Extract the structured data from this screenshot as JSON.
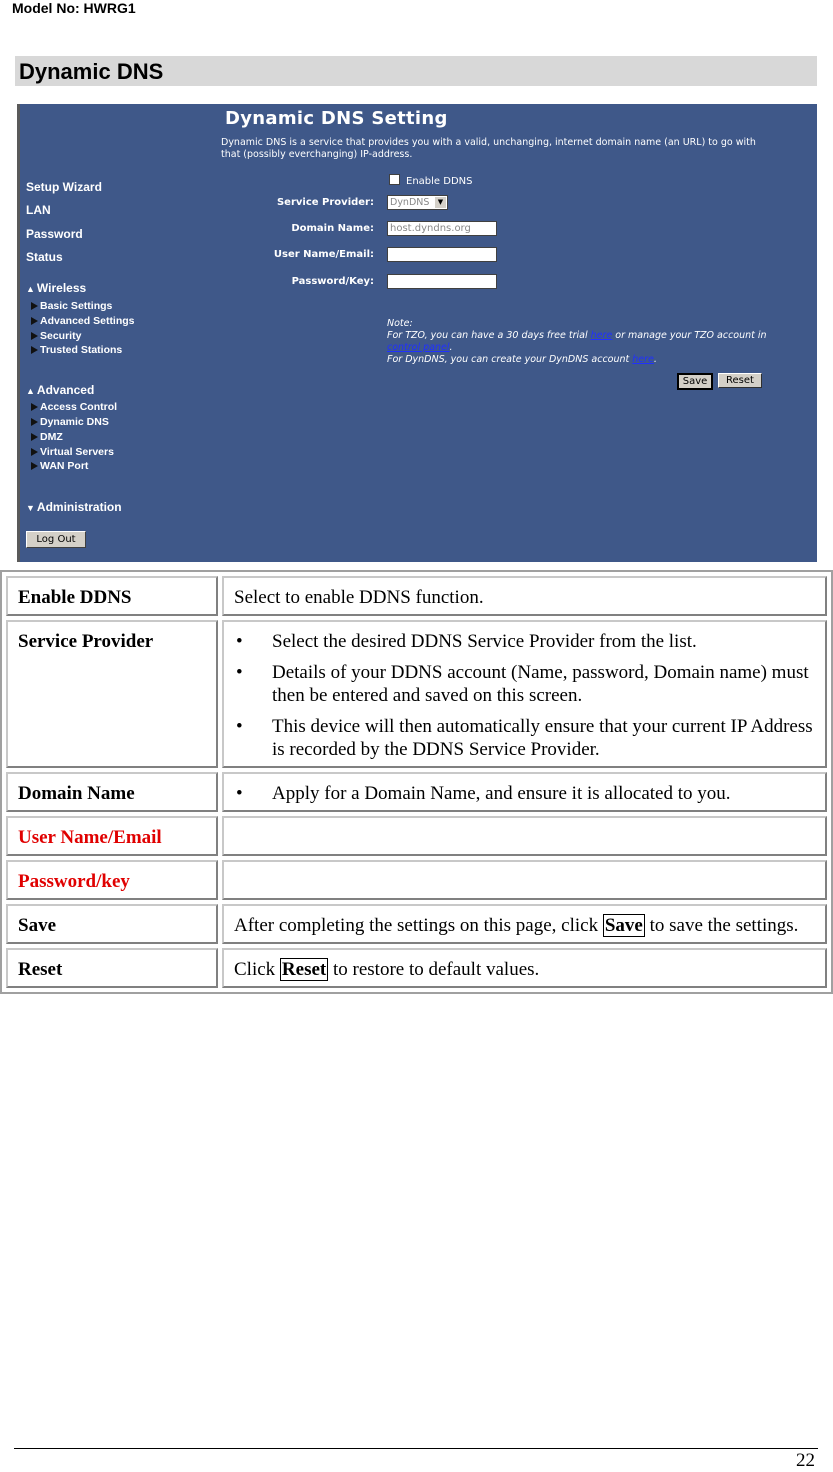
{
  "header": {
    "model": "Model No: HWRG1"
  },
  "section_title": "Dynamic DNS",
  "screenshot": {
    "title": "Dynamic DNS  Setting",
    "intro": "Dynamic DNS is a service that provides you with a valid, unchanging, internet domain name (an URL) to go with that (possibly everchanging) IP-address.",
    "nav": {
      "top": [
        "Setup Wizard",
        "LAN",
        "Password",
        "Status"
      ],
      "wireless": {
        "label": "Wireless",
        "items": [
          "Basic Settings",
          "Advanced Settings",
          "Security",
          "Trusted Stations"
        ]
      },
      "advanced": {
        "label": "Advanced",
        "items": [
          "Access Control",
          "Dynamic DNS",
          "DMZ",
          "Virtual Servers",
          "WAN Port"
        ]
      },
      "administration": {
        "label": "Administration"
      },
      "logout": "Log Out"
    },
    "form": {
      "enable_label": "Enable DDNS",
      "enable_checked": false,
      "service_provider_label": "Service Provider:",
      "service_provider_value": "DynDNS",
      "domain_name_label": "Domain Name:",
      "domain_name_value": "host.dyndns.org",
      "username_label": "User Name/Email:",
      "username_value": "",
      "password_label": "Password/Key:",
      "password_value": ""
    },
    "note": {
      "title": "Note:",
      "line1_pre": "For TZO, you can have a 30 days free trial ",
      "link_here": "here",
      "line1_mid": " or manage your TZO account in ",
      "link_control_panel": "control panel",
      "line1_end": ".",
      "line2_pre": "For DynDNS, you can create your DynDNS account ",
      "line2_end": "."
    },
    "save": "Save",
    "reset": "Reset"
  },
  "table": {
    "enable": {
      "key": "Enable DDNS",
      "value": "Select to enable DDNS function."
    },
    "provider": {
      "key": "Service Provider",
      "bullets": [
        "Select the desired DDNS Service Provider from the list.",
        "Details of your DDNS account (Name, password, Domain name) must then be entered and saved on this screen.",
        "This device will then automatically ensure that your current IP Address is recorded by the DDNS Service Provider."
      ]
    },
    "domain": {
      "key": "Domain Name",
      "bullets": [
        "Apply for a Domain Name, and ensure it is allocated to you."
      ]
    },
    "username": {
      "key": "User Name/Email",
      "value": ""
    },
    "password": {
      "key": "Password/key",
      "value": ""
    },
    "save": {
      "key": "Save",
      "pre": "After completing the settings on this page, click ",
      "btn": "Save",
      "post": " to save the settings."
    },
    "reset": {
      "key": "Reset",
      "pre": "Click ",
      "btn": "Reset",
      "post": " to restore to default values."
    }
  },
  "footer": {
    "page_number": "22"
  }
}
